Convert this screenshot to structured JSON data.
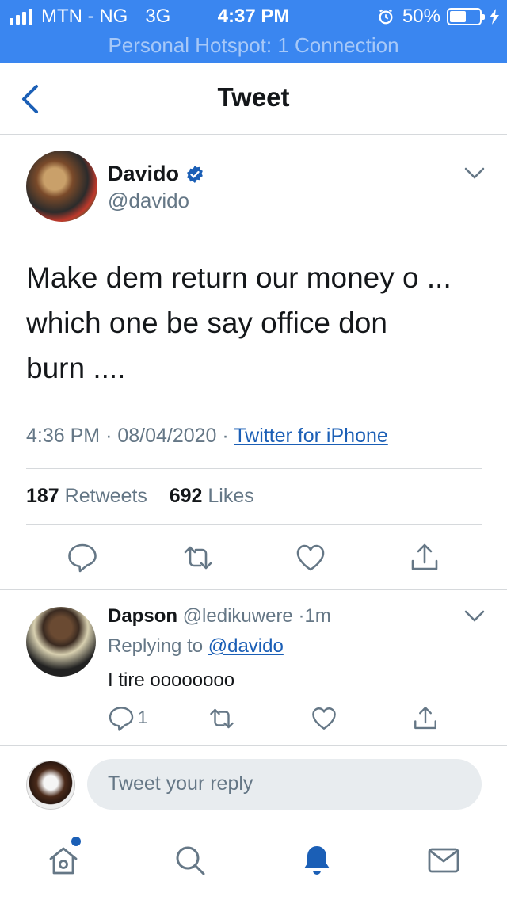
{
  "status_bar": {
    "carrier": "MTN - NG",
    "network": "3G",
    "time": "4:37 PM",
    "battery": "50%",
    "hotspot": "Personal Hotspot: 1 Connection",
    "color": "#3a86f0"
  },
  "nav": {
    "title": "Tweet"
  },
  "tweet": {
    "author_name": "Davido",
    "author_handle": "@davido",
    "text_lines": [
      "Make  dem return our money o ...",
      "which one be say office don",
      "burn ...."
    ],
    "time": "4:36 PM",
    "date": "08/04/2020",
    "source": "Twitter for iPhone",
    "retweets": "187",
    "retweets_label": "Retweets",
    "likes": "692",
    "likes_label": "Likes"
  },
  "reply": {
    "author_name": "Dapson",
    "author_handle": "@ledikuwere",
    "age": "1m",
    "replying_label": "Replying to",
    "replying_handle": "@davido",
    "text": "I tire oooooooo",
    "reply_count": "1"
  },
  "compose": {
    "placeholder": "Tweet your reply"
  },
  "tab_bar": {
    "icons": [
      "home-icon",
      "search-icon",
      "notifications-icon",
      "messages-icon"
    ],
    "active": "notifications-icon"
  },
  "colors": {
    "accent": "#1b5fb6",
    "secondary_text": "#657786",
    "primary_text": "#14171a"
  }
}
